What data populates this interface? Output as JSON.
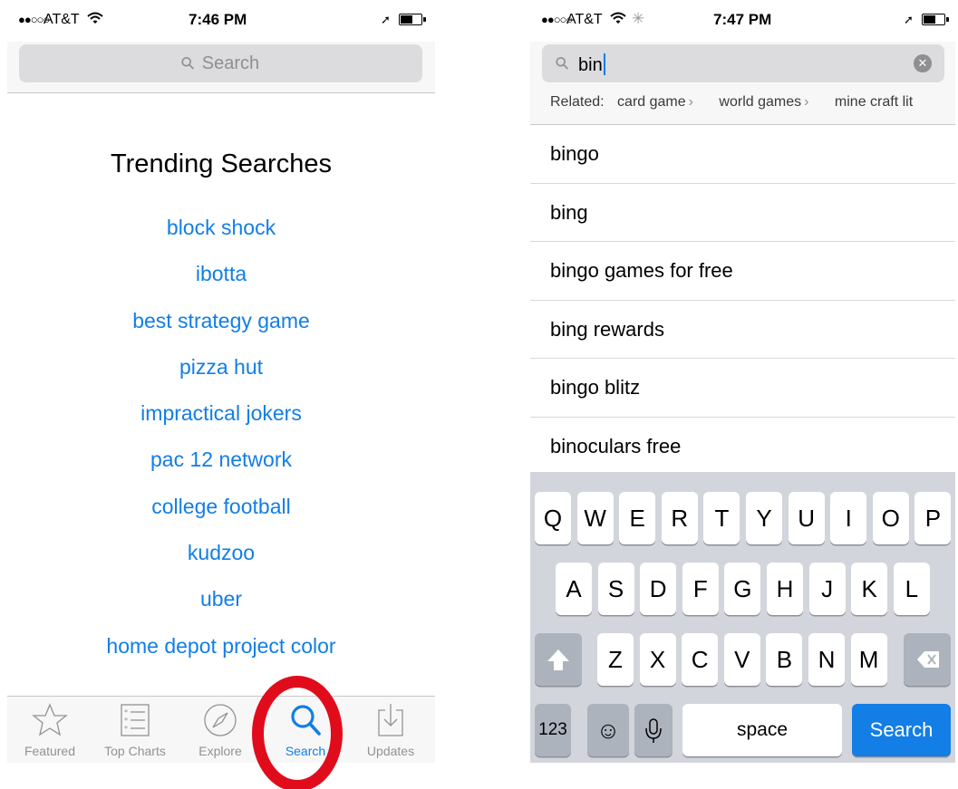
{
  "left": {
    "status": {
      "signal": "●●○○○",
      "carrier": "AT&T",
      "time": "7:46 PM"
    },
    "search_placeholder": "Search",
    "trending_title": "Trending Searches",
    "trending": [
      "block shock",
      "ibotta",
      "best strategy game",
      "pizza hut",
      "impractical jokers",
      "pac 12 network",
      "college football",
      "kudzoo",
      "uber",
      "home depot project color"
    ],
    "tabs": [
      {
        "label": "Featured",
        "icon": "star-icon"
      },
      {
        "label": "Top Charts",
        "icon": "list-icon"
      },
      {
        "label": "Explore",
        "icon": "compass-icon"
      },
      {
        "label": "Search",
        "icon": "search-icon",
        "active": true
      },
      {
        "label": "Updates",
        "icon": "download-icon"
      }
    ]
  },
  "right": {
    "status": {
      "signal": "●●○○○",
      "carrier": "AT&T",
      "time": "7:47 PM"
    },
    "query": "bin",
    "related_label": "Related:",
    "related": [
      "card game",
      "world games",
      "mine craft lit"
    ],
    "suggestions": [
      "bingo",
      "bing",
      "bingo games for free",
      "bing rewards",
      "bingo blitz",
      "binoculars free"
    ],
    "keyboard": {
      "row1": [
        "Q",
        "W",
        "E",
        "R",
        "T",
        "Y",
        "U",
        "I",
        "O",
        "P"
      ],
      "row2": [
        "A",
        "S",
        "D",
        "F",
        "G",
        "H",
        "J",
        "K",
        "L"
      ],
      "row3": [
        "Z",
        "X",
        "C",
        "V",
        "B",
        "N",
        "M"
      ],
      "numbers_label": "123",
      "space_label": "space",
      "search_label": "Search"
    }
  },
  "colors": {
    "accent": "#127ee6",
    "highlight": "#e10c1b"
  }
}
